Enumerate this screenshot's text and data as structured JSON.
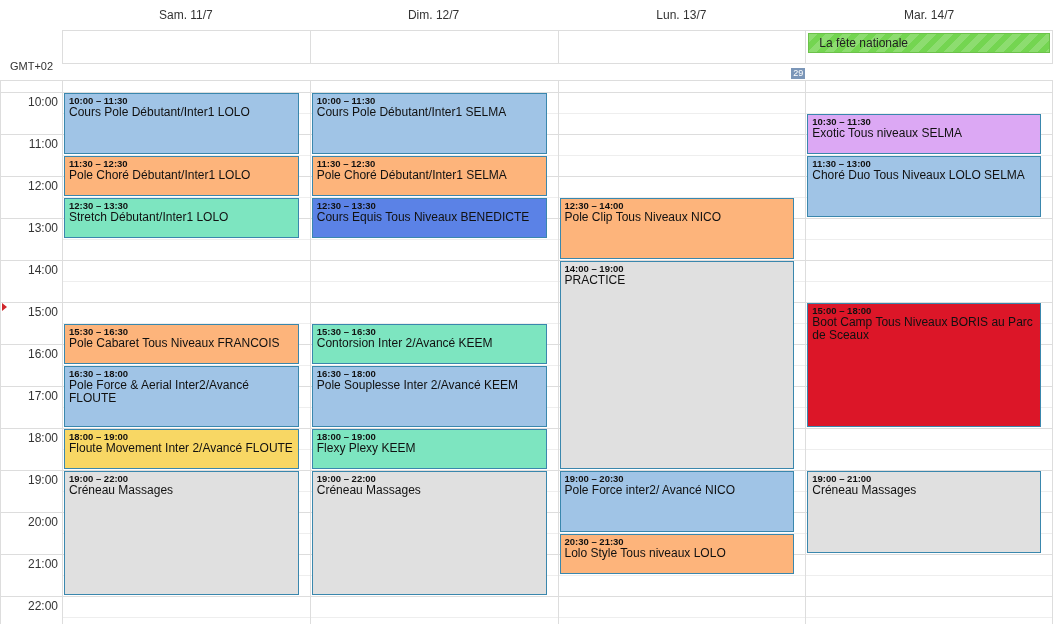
{
  "timezone": "GMT+02",
  "week_number": "29",
  "hours": [
    "10:00",
    "11:00",
    "12:00",
    "13:00",
    "14:00",
    "15:00",
    "16:00",
    "17:00",
    "18:00",
    "19:00",
    "20:00",
    "21:00",
    "22:00"
  ],
  "days": [
    {
      "label": "Sam. 11/7",
      "events": [
        {
          "time": "10:00 – 11:30",
          "title": "Cours Pole Débutant/Inter1 LOLO",
          "color": "#a0c4e6"
        },
        {
          "time": "11:30 – 12:30",
          "title": "Pole Choré Débutant/Inter1 LOLO",
          "color": "#fdb47b"
        },
        {
          "time": "12:30 – 13:30",
          "title": "Stretch Débutant/Inter1 LOLO",
          "color": "#7de5c0"
        },
        {
          "time": "15:30 – 16:30",
          "title": "Pole Cabaret Tous Niveaux FRANCOIS",
          "color": "#fdb47b"
        },
        {
          "time": "16:30 – 18:00",
          "title": "Pole Force & Aerial Inter2/Avancé FLOUTE",
          "color": "#a0c4e6"
        },
        {
          "time": "18:00 – 19:00",
          "title": "Floute Movement Inter 2/Avancé FLOUTE",
          "color": "#f8d764"
        },
        {
          "time": "19:00 – 22:00",
          "title": "Créneau Massages",
          "color": "#e0e0e0"
        }
      ]
    },
    {
      "label": "Dim. 12/7",
      "events": [
        {
          "time": "10:00 – 11:30",
          "title": "Cours Pole Débutant/Inter1 SELMA",
          "color": "#a0c4e6"
        },
        {
          "time": "11:30 – 12:30",
          "title": "Pole Choré Débutant/Inter1 SELMA",
          "color": "#fdb47b"
        },
        {
          "time": "12:30 – 13:30",
          "title": "Cours Equis Tous Niveaux BENEDICTE",
          "color": "#5b82e6"
        },
        {
          "time": "15:30 – 16:30",
          "title": "Contorsion Inter 2/Avancé KEEM",
          "color": "#7de5c0"
        },
        {
          "time": "16:30 – 18:00",
          "title": "Pole Souplesse Inter 2/Avancé KEEM",
          "color": "#a0c4e6"
        },
        {
          "time": "18:00 – 19:00",
          "title": "Flexy Plexy KEEM",
          "color": "#7de5c0"
        },
        {
          "time": "19:00 – 22:00",
          "title": "Créneau Massages",
          "color": "#e0e0e0"
        }
      ]
    },
    {
      "label": "Lun. 13/7",
      "events": [
        {
          "time": "12:30 – 14:00",
          "title": "Pole Clip Tous Niveaux NICO",
          "color": "#fdb47b"
        },
        {
          "time": "14:00 – 19:00",
          "title": "PRACTICE",
          "color": "#e0e0e0"
        },
        {
          "time": "19:00 – 20:30",
          "title": "Pole Force inter2/ Avancé NICO",
          "color": "#a0c4e6"
        },
        {
          "time": "20:30 – 21:30",
          "title": "Lolo Style Tous niveaux LOLO",
          "color": "#fdb47b"
        }
      ]
    },
    {
      "label": "Mar. 14/7",
      "all_day": [
        {
          "title": "La fête nationale",
          "color": "#74d551"
        }
      ],
      "events": [
        {
          "time": "10:30 – 11:30",
          "title": "Exotic Tous niveaux SELMA",
          "color": "#dca8f4"
        },
        {
          "time": "11:30 – 13:00",
          "title": "Choré Duo Tous Niveaux LOLO SELMA",
          "color": "#a0c4e6"
        },
        {
          "time": "15:00 – 18:00",
          "title": "Boot Camp Tous Niveaux BORIS au Parc de Sceaux",
          "color": "#dc1628"
        },
        {
          "time": "19:00 – 21:00",
          "title": "Créneau Massages",
          "color": "#e0e0e0"
        }
      ]
    }
  ]
}
